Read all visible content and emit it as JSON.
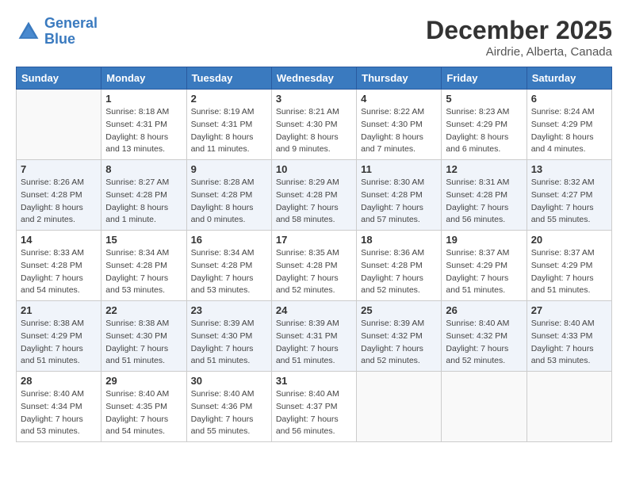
{
  "header": {
    "logo_line1": "General",
    "logo_line2": "Blue",
    "month": "December 2025",
    "location": "Airdrie, Alberta, Canada"
  },
  "weekdays": [
    "Sunday",
    "Monday",
    "Tuesday",
    "Wednesday",
    "Thursday",
    "Friday",
    "Saturday"
  ],
  "weeks": [
    [
      {
        "day": "",
        "info": ""
      },
      {
        "day": "1",
        "info": "Sunrise: 8:18 AM\nSunset: 4:31 PM\nDaylight: 8 hours\nand 13 minutes."
      },
      {
        "day": "2",
        "info": "Sunrise: 8:19 AM\nSunset: 4:31 PM\nDaylight: 8 hours\nand 11 minutes."
      },
      {
        "day": "3",
        "info": "Sunrise: 8:21 AM\nSunset: 4:30 PM\nDaylight: 8 hours\nand 9 minutes."
      },
      {
        "day": "4",
        "info": "Sunrise: 8:22 AM\nSunset: 4:30 PM\nDaylight: 8 hours\nand 7 minutes."
      },
      {
        "day": "5",
        "info": "Sunrise: 8:23 AM\nSunset: 4:29 PM\nDaylight: 8 hours\nand 6 minutes."
      },
      {
        "day": "6",
        "info": "Sunrise: 8:24 AM\nSunset: 4:29 PM\nDaylight: 8 hours\nand 4 minutes."
      }
    ],
    [
      {
        "day": "7",
        "info": "Sunrise: 8:26 AM\nSunset: 4:28 PM\nDaylight: 8 hours\nand 2 minutes."
      },
      {
        "day": "8",
        "info": "Sunrise: 8:27 AM\nSunset: 4:28 PM\nDaylight: 8 hours\nand 1 minute."
      },
      {
        "day": "9",
        "info": "Sunrise: 8:28 AM\nSunset: 4:28 PM\nDaylight: 8 hours\nand 0 minutes."
      },
      {
        "day": "10",
        "info": "Sunrise: 8:29 AM\nSunset: 4:28 PM\nDaylight: 7 hours\nand 58 minutes."
      },
      {
        "day": "11",
        "info": "Sunrise: 8:30 AM\nSunset: 4:28 PM\nDaylight: 7 hours\nand 57 minutes."
      },
      {
        "day": "12",
        "info": "Sunrise: 8:31 AM\nSunset: 4:28 PM\nDaylight: 7 hours\nand 56 minutes."
      },
      {
        "day": "13",
        "info": "Sunrise: 8:32 AM\nSunset: 4:27 PM\nDaylight: 7 hours\nand 55 minutes."
      }
    ],
    [
      {
        "day": "14",
        "info": "Sunrise: 8:33 AM\nSunset: 4:28 PM\nDaylight: 7 hours\nand 54 minutes."
      },
      {
        "day": "15",
        "info": "Sunrise: 8:34 AM\nSunset: 4:28 PM\nDaylight: 7 hours\nand 53 minutes."
      },
      {
        "day": "16",
        "info": "Sunrise: 8:34 AM\nSunset: 4:28 PM\nDaylight: 7 hours\nand 53 minutes."
      },
      {
        "day": "17",
        "info": "Sunrise: 8:35 AM\nSunset: 4:28 PM\nDaylight: 7 hours\nand 52 minutes."
      },
      {
        "day": "18",
        "info": "Sunrise: 8:36 AM\nSunset: 4:28 PM\nDaylight: 7 hours\nand 52 minutes."
      },
      {
        "day": "19",
        "info": "Sunrise: 8:37 AM\nSunset: 4:29 PM\nDaylight: 7 hours\nand 51 minutes."
      },
      {
        "day": "20",
        "info": "Sunrise: 8:37 AM\nSunset: 4:29 PM\nDaylight: 7 hours\nand 51 minutes."
      }
    ],
    [
      {
        "day": "21",
        "info": "Sunrise: 8:38 AM\nSunset: 4:29 PM\nDaylight: 7 hours\nand 51 minutes."
      },
      {
        "day": "22",
        "info": "Sunrise: 8:38 AM\nSunset: 4:30 PM\nDaylight: 7 hours\nand 51 minutes."
      },
      {
        "day": "23",
        "info": "Sunrise: 8:39 AM\nSunset: 4:30 PM\nDaylight: 7 hours\nand 51 minutes."
      },
      {
        "day": "24",
        "info": "Sunrise: 8:39 AM\nSunset: 4:31 PM\nDaylight: 7 hours\nand 51 minutes."
      },
      {
        "day": "25",
        "info": "Sunrise: 8:39 AM\nSunset: 4:32 PM\nDaylight: 7 hours\nand 52 minutes."
      },
      {
        "day": "26",
        "info": "Sunrise: 8:40 AM\nSunset: 4:32 PM\nDaylight: 7 hours\nand 52 minutes."
      },
      {
        "day": "27",
        "info": "Sunrise: 8:40 AM\nSunset: 4:33 PM\nDaylight: 7 hours\nand 53 minutes."
      }
    ],
    [
      {
        "day": "28",
        "info": "Sunrise: 8:40 AM\nSunset: 4:34 PM\nDaylight: 7 hours\nand 53 minutes."
      },
      {
        "day": "29",
        "info": "Sunrise: 8:40 AM\nSunset: 4:35 PM\nDaylight: 7 hours\nand 54 minutes."
      },
      {
        "day": "30",
        "info": "Sunrise: 8:40 AM\nSunset: 4:36 PM\nDaylight: 7 hours\nand 55 minutes."
      },
      {
        "day": "31",
        "info": "Sunrise: 8:40 AM\nSunset: 4:37 PM\nDaylight: 7 hours\nand 56 minutes."
      },
      {
        "day": "",
        "info": ""
      },
      {
        "day": "",
        "info": ""
      },
      {
        "day": "",
        "info": ""
      }
    ]
  ]
}
